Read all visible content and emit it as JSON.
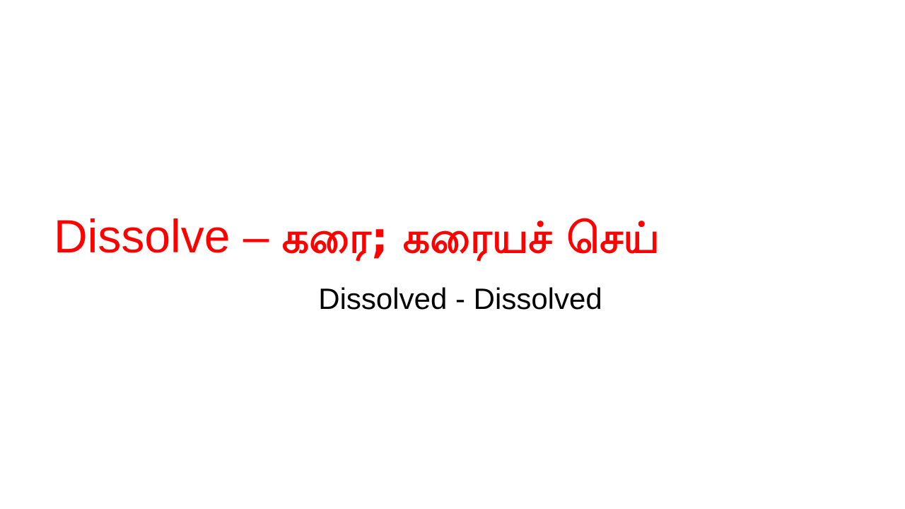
{
  "headline": {
    "english": "Dissolve",
    "separator": "–",
    "tamil": "கரை; கரையச் செய்"
  },
  "subline": {
    "text": "Dissolved - Dissolved"
  },
  "colors": {
    "background": "#ffffff",
    "headline": "#ff0000",
    "subline": "#000000"
  }
}
